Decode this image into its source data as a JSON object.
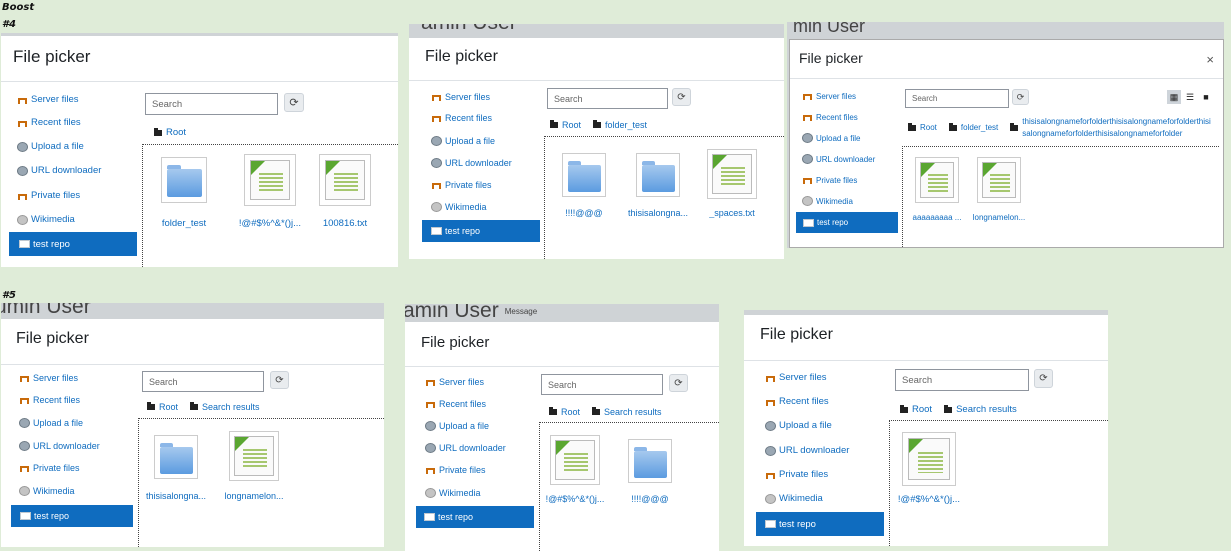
{
  "labels": {
    "theme": "Boost",
    "row1": "#4",
    "row2": "#5"
  },
  "dialog_title": "File picker",
  "close_glyph": "×",
  "ghost_text": "min User",
  "ghost_text_full": "umin User",
  "ghost_text_b": "amin User",
  "ghost_small": "Message",
  "search_placeholder": "Search",
  "sidebar": [
    "Server files",
    "Recent files",
    "Upload a file",
    "URL downloader",
    "Private files",
    "Wikimedia",
    "test repo"
  ],
  "crumbs": {
    "root": "Root",
    "folder_test": "folder_test",
    "long_folder": "thisisalongnameforfolderthisisalongnameforfolderthisisalongnameforfolderthisisalongnameforfolder",
    "search_results": "Search results"
  },
  "files": {
    "folder_test": "folder_test",
    "special": "!@#$%^&*()j...",
    "f100816": "100816.txt",
    "excl": "!!!!@@@",
    "long_folder": "thisisalongna...",
    "spaces": "_spaces.txt",
    "aaaa": "aaaaaaaaa ...",
    "longname": "longnamelon..."
  },
  "colors": {
    "accent": "#0f6cbf",
    "background": "#dfecd8"
  }
}
